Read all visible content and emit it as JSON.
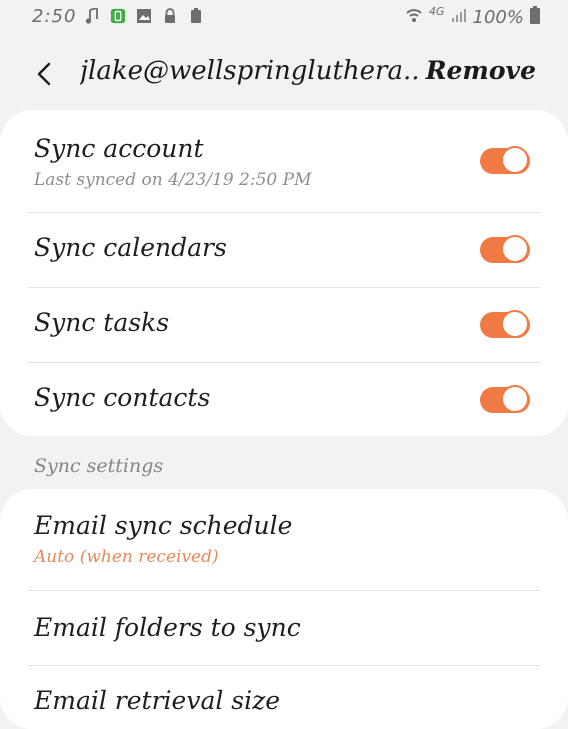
{
  "status_bar": {
    "time": "2:50",
    "icons": [
      "music-note-icon",
      "phone-app-icon",
      "image-icon",
      "lock-icon",
      "battery-saver-icon"
    ],
    "network": "4G",
    "battery": "100%"
  },
  "header": {
    "title": "jlake@wellspringluthera...",
    "action": "Remove"
  },
  "sync_items": [
    {
      "label": "Sync account",
      "subtitle": "Last synced on 4/23/19 2:50 PM",
      "enabled": true
    },
    {
      "label": "Sync calendars",
      "enabled": true
    },
    {
      "label": "Sync tasks",
      "enabled": true
    },
    {
      "label": "Sync contacts",
      "enabled": true
    }
  ],
  "section_header": "Sync settings",
  "settings_items": [
    {
      "label": "Email sync schedule",
      "subtitle": "Auto (when received)"
    },
    {
      "label": "Email folders to sync"
    },
    {
      "label": "Email retrieval size"
    }
  ],
  "colors": {
    "accent": "#f07a44",
    "subtitle_accent": "#e68a5c",
    "background": "#f2f2f2"
  }
}
